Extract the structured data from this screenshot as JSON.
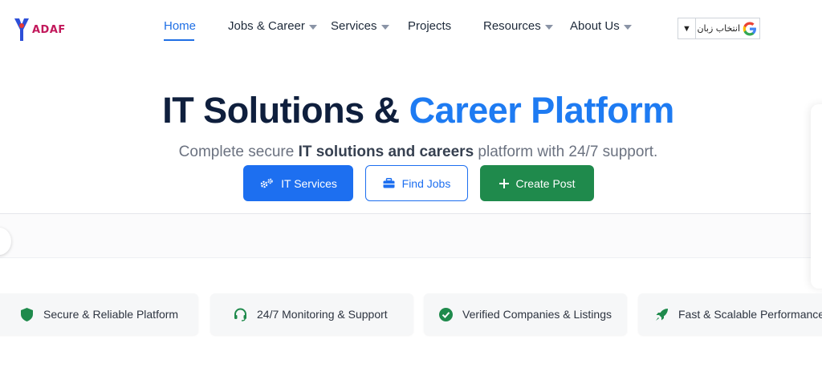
{
  "brand": {
    "logo_text": "ADAF"
  },
  "nav": {
    "items": [
      {
        "label": "Home",
        "active": true,
        "dropdown": false
      },
      {
        "label": "Jobs & Career",
        "active": false,
        "dropdown": true
      },
      {
        "label": "Services",
        "active": false,
        "dropdown": true
      },
      {
        "label": "Projects",
        "active": false,
        "dropdown": false
      },
      {
        "label": "Resources",
        "active": false,
        "dropdown": true
      },
      {
        "label": "About Us",
        "active": false,
        "dropdown": true
      }
    ]
  },
  "language": {
    "label": "انتخاب زبان",
    "arrow": "▼",
    "icon": "google-g-icon"
  },
  "hero": {
    "title_main": "IT Solutions & ",
    "title_accent": "Career Platform",
    "subtitle_pre": "Complete secure ",
    "subtitle_bold": "IT solutions and careers",
    "subtitle_post": " platform with 24/7 support."
  },
  "actions": {
    "it_services": "IT Services",
    "find_jobs": "Find Jobs",
    "create_post": "Create Post"
  },
  "features": [
    {
      "label": "Secure & Reliable Platform",
      "icon": "shield-icon"
    },
    {
      "label": "24/7 Monitoring & Support",
      "icon": "headset-icon"
    },
    {
      "label": "Verified Companies & Listings",
      "icon": "check-circle-icon"
    },
    {
      "label": "Fast & Scalable Performance",
      "icon": "rocket-icon"
    }
  ],
  "colors": {
    "primary": "#1d6ff0",
    "accent_text": "#1e7bf2",
    "success": "#1f8a4c",
    "title": "#0f1f3d",
    "brand_magenta": "#c2185b"
  }
}
